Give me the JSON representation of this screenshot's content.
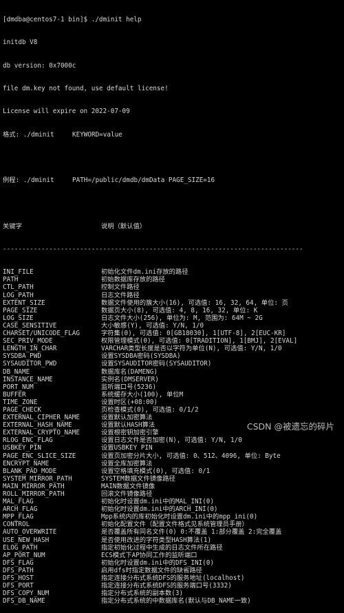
{
  "terminal": {
    "prompt": "[dmdba@centos7-1 bin]$ ./dminit help",
    "intro_lines": [
      "initdb V8",
      "db version: 0x7000c",
      "file dm.key not found, use default license!",
      "License will expire on 2022-07-09"
    ],
    "format": {
      "label": "格式: ./dminit",
      "value": "KEYWORD=value"
    },
    "example": {
      "label": "例程: ./dminit",
      "value": "PATH=/public/dmdb/dmData PAGE_SIZE=16"
    },
    "table_header": {
      "keyword": "关键字",
      "description": "说明（默认值）"
    },
    "divider": "------------------------------------------------------------------------------",
    "rows": [
      {
        "key": "INI_FILE",
        "desc": "初始化文件dm.ini存放的路径"
      },
      {
        "key": "PATH",
        "desc": "初始数据库存放的路径"
      },
      {
        "key": "CTL_PATH",
        "desc": "控制文件路径"
      },
      {
        "key": "LOG_PATH",
        "desc": "日志文件路径"
      },
      {
        "key": "EXTENT_SIZE",
        "desc": "数据文件使用的簇大小(16), 可选值: 16, 32, 64, 单位: 页"
      },
      {
        "key": "PAGE_SIZE",
        "desc": "数据页大小(8), 可选值: 4, 8, 16, 32, 单位: K"
      },
      {
        "key": "LOG_SIZE",
        "desc": "日志文件大小(256), 单位为: M, 范围为: 64M ~ 2G"
      },
      {
        "key": "CASE_SENSITIVE",
        "desc": "大小敏感(Y), 可选值: Y/N, 1/0"
      },
      {
        "key": "CHARSET/UNICODE_FLAG",
        "desc": "字符集(0), 可选值: 0[GB18030], 1[UTF-8], 2[EUC-KR]"
      },
      {
        "key": "SEC_PRIV_MODE",
        "desc": "权限管理模式(0), 可选值: 0[TRADITION], 1[BMJ], 2[EVAL]"
      },
      {
        "key": "LENGTH_IN_CHAR",
        "desc": "VARCHAR类型长度是否以字符为单位(N), 可选值: Y/N, 1/0"
      },
      {
        "key": "SYSDBA_PWD",
        "desc": "设置SYSDBA密码(SYSDBA)"
      },
      {
        "key": "SYSAUDITOR_PWD",
        "desc": "设置SYSAUDITOR密码(SYSAUDITOR)"
      },
      {
        "key": "DB_NAME",
        "desc": "数据库名(DAMENG)"
      },
      {
        "key": "INSTANCE_NAME",
        "desc": "实例名(DMSERVER)"
      },
      {
        "key": "PORT_NUM",
        "desc": "监听端口号(5236)"
      },
      {
        "key": "BUFFER",
        "desc": "系统缓存大小(100), 单位M"
      },
      {
        "key": "TIME_ZONE",
        "desc": "设置时区(+08:00)"
      },
      {
        "key": "PAGE_CHECK",
        "desc": "页检查模式(0), 可选值: 0/1/2"
      },
      {
        "key": "EXTERNAL_CIPHER_NAME",
        "desc": "设置默认加密算法"
      },
      {
        "key": "EXTERNAL_HASH_NAME",
        "desc": "设置默认HASH算法"
      },
      {
        "key": "EXTERNAL_CRYPTO_NAME",
        "desc": "设置根密钥加密引擎"
      },
      {
        "key": "RLOG_ENC_FLAG",
        "desc": "设置日志文件是否加密(N), 可选值: Y/N, 1/0"
      },
      {
        "key": "USBKEY_PIN",
        "desc": "设置USBKEY PIN"
      },
      {
        "key": "PAGE_ENC_SLICE_SIZE",
        "desc": "设置页加密分片大小, 可选值: 0、512、4096, 单位: Byte"
      },
      {
        "key": "ENCRYPT_NAME",
        "desc": "设置全库加密算法"
      },
      {
        "key": "BLANK_PAD_MODE",
        "desc": "设置空格填充模式(0), 可选值: 0/1"
      },
      {
        "key": "SYSTEM_MIRROR_PATH",
        "desc": "SYSTEM数据文件镜像路径"
      },
      {
        "key": "MAIN_MIRROR_PATH",
        "desc": "MAIN数据文件镜像"
      },
      {
        "key": "ROLL_MIRROR_PATH",
        "desc": "回滚文件镜像路径"
      },
      {
        "key": "MAL_FLAG",
        "desc": "初始化时设置dm.ini中的MAL_INI(0)"
      },
      {
        "key": "ARCH_FLAG",
        "desc": "初始化时设置dm.ini中的ARCH_INI(0)"
      },
      {
        "key": "MPP_FLAG",
        "desc": "Mpp系统内的库初始化时设置dm.ini中的mpp_ini(0)"
      },
      {
        "key": "CONTROL",
        "desc": "初始化配置文件（配置文件格式见系统管理员手册）"
      },
      {
        "key": "AUTO_OVERWRITE",
        "desc": "是否覆盖所有同名文件(0) 0:不覆盖 1:部分覆盖 2:完全覆盖"
      },
      {
        "key": "USE_NEW_HASH",
        "desc": "是否使用改进的字符类型HASH算法(1)"
      },
      {
        "key": "ELOG_PATH",
        "desc": "指定初始化过程中生成的日志文件所在路径"
      },
      {
        "key": "AP_PORT_NUM",
        "desc": "ECS模式下AP协同工作的监听端口"
      },
      {
        "key": "DFS_FLAG",
        "desc": "初始化时设置dm.ini中的DFS_INI(0)"
      },
      {
        "key": "DFS_PATH",
        "desc": "启用dfs时指定数据文件的缺省路径"
      },
      {
        "key": "DFS_HOST",
        "desc": "指定连接分布式系统DFS的服务地址(localhost)"
      },
      {
        "key": "DFS_PORT",
        "desc": "指定连接分布式系统DFS的服务端口号(3332)"
      },
      {
        "key": "DFS_COPY_NUM",
        "desc": "指定分布式系统的副本数(3)"
      },
      {
        "key": "DFS_DB_NAME",
        "desc": "指定分布式系统的中数据库名(默认与DB_NAME一致)"
      }
    ]
  },
  "watermark": "CSDN @被遗忘的碎片",
  "colors": {
    "background": "#000000",
    "foreground": "#d8d8d8"
  }
}
